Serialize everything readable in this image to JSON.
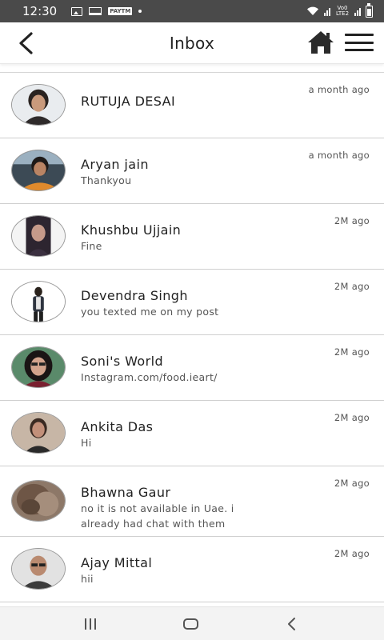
{
  "status_bar": {
    "time": "12:30",
    "volte_text": "Vo0 LTE2",
    "tag": "PAYTM"
  },
  "header": {
    "title": "Inbox"
  },
  "messages": [
    {
      "name": "RUTUJA DESAI",
      "message": "",
      "time": "a month ago"
    },
    {
      "name": "Aryan jain",
      "message": "Thankyou",
      "time": "a month ago"
    },
    {
      "name": "Khushbu Ujjain",
      "message": "Fine",
      "time": "2M ago"
    },
    {
      "name": "Devendra Singh",
      "message": "you texted me on my post",
      "time": "2M ago"
    },
    {
      "name": "Soni's World",
      "message": "Instagram.com/food.ieart/",
      "time": "2M ago"
    },
    {
      "name": "Ankita Das",
      "message": "Hi",
      "time": "2M ago"
    },
    {
      "name": "Bhawna Gaur",
      "message": "no it is not available in Uae. i already had chat with them",
      "time": "2M ago"
    },
    {
      "name": "Ajay Mittal",
      "message": "hii",
      "time": "2M ago"
    }
  ],
  "colors": {
    "status_bar_bg": "#4a4a4a",
    "divider": "#cfcfcf",
    "nav_bar_bg": "#f3f3f3",
    "icon": "#222222"
  },
  "icons": {
    "back": "chevron-left-icon",
    "home": "home-icon",
    "menu": "hamburger-menu-icon"
  }
}
